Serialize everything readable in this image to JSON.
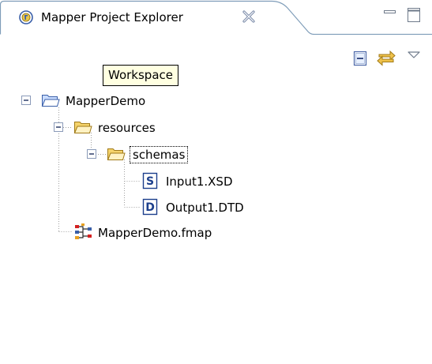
{
  "view": {
    "title": "Mapper Project Explorer",
    "tooltip": "Workspace"
  },
  "icons": {
    "view_icon": "mapper-view-icon",
    "close": "close-icon",
    "minimize": "minimize-icon",
    "maximize": "maximize-icon",
    "collapse_all": "collapse-all-icon",
    "link_with_editor": "link-with-editor-icon",
    "view_menu": "view-menu-icon"
  },
  "tree": {
    "project": {
      "label": "MapperDemo",
      "icon": "project-folder-icon",
      "expanded": true
    },
    "resources": {
      "label": "resources",
      "icon": "folder-open-icon",
      "expanded": true
    },
    "schemas": {
      "label": "schemas",
      "icon": "folder-open-icon",
      "expanded": true,
      "focused": true
    },
    "input": {
      "label": "Input1.XSD",
      "icon": "xsd-file-icon",
      "glyph": "S"
    },
    "output": {
      "label": "Output1.DTD",
      "icon": "dtd-file-icon",
      "glyph": "D"
    },
    "map": {
      "label": "MapperDemo.fmap",
      "icon": "map-file-icon"
    }
  },
  "colors": {
    "tab_border": "#7f9db9",
    "tree_line": "#a0a0a0",
    "tooltip_bg": "#ffffe1",
    "folder_yellow": "#f5d36b",
    "file_blue": "#1c3f8c"
  }
}
